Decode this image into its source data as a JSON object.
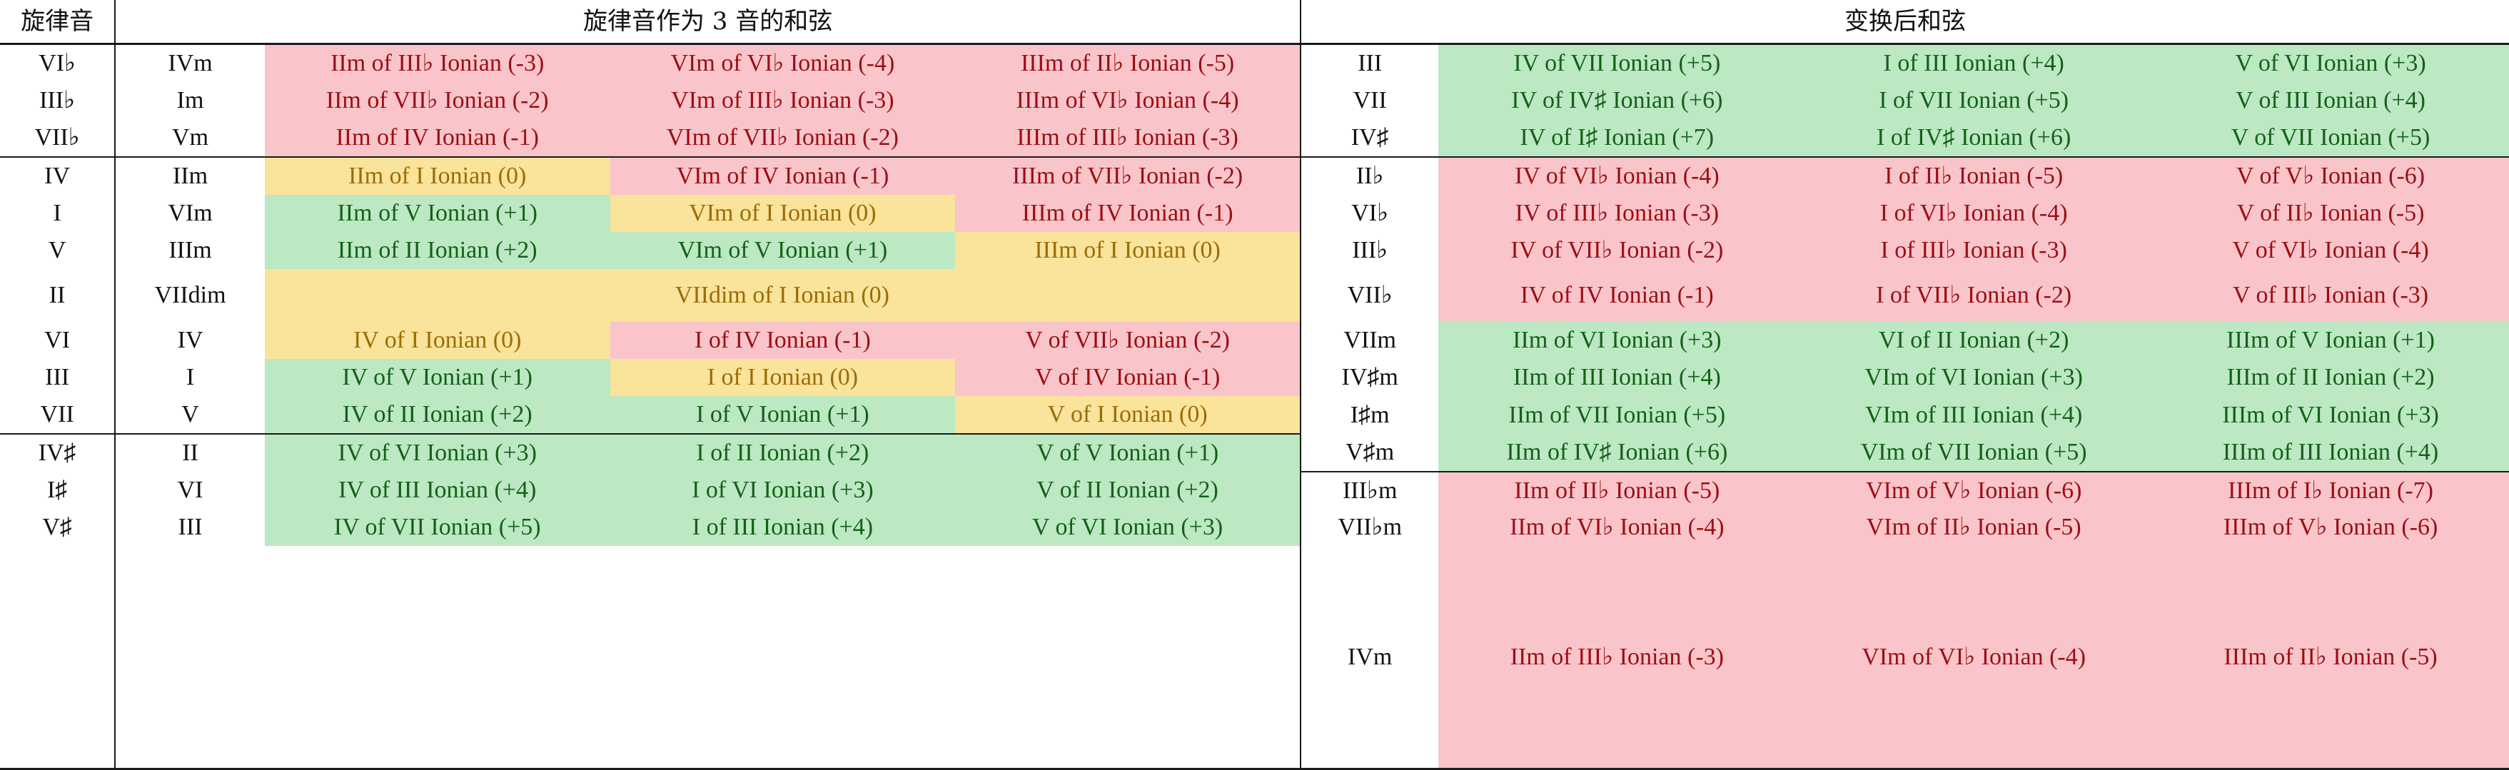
{
  "header": {
    "melody_label": "旋律音",
    "left_group": "旋律音作为 3 音的和弦",
    "right_group": "变换后和弦"
  },
  "left_table": {
    "blocks": [
      {
        "rows": [
          {
            "melody": "VI♭",
            "chord": "IVm",
            "color": [
              "pink",
              "pink",
              "pink"
            ],
            "cells": [
              "IIm of III♭ Ionian (-3)",
              "VIm of VI♭ Ionian (-4)",
              "IIIm of II♭ Ionian (-5)"
            ]
          },
          {
            "melody": "III♭",
            "chord": "Im",
            "color": [
              "pink",
              "pink",
              "pink"
            ],
            "cells": [
              "IIm of VII♭ Ionian (-2)",
              "VIm of III♭ Ionian (-3)",
              "IIIm of VI♭ Ionian (-4)"
            ]
          },
          {
            "melody": "VII♭",
            "chord": "Vm",
            "color": [
              "pink",
              "pink",
              "pink"
            ],
            "cells": [
              "IIm of IV Ionian (-1)",
              "VIm of VII♭ Ionian (-2)",
              "IIIm of III♭ Ionian (-3)"
            ]
          }
        ]
      },
      {
        "rows": [
          {
            "melody": "IV",
            "chord": "IIm",
            "color": [
              "yellow",
              "pink",
              "pink"
            ],
            "cells": [
              "IIm of I Ionian (0)",
              "VIm of IV Ionian (-1)",
              "IIIm of VII♭ Ionian (-2)"
            ]
          },
          {
            "melody": "I",
            "chord": "VIm",
            "color": [
              "green",
              "yellow",
              "pink"
            ],
            "cells": [
              "IIm of V Ionian (+1)",
              "VIm of I Ionian (0)",
              "IIIm of IV Ionian (-1)"
            ]
          },
          {
            "melody": "V",
            "chord": "IIIm",
            "color": [
              "green",
              "green",
              "yellow"
            ],
            "cells": [
              "IIm of II Ionian (+2)",
              "VIm of V Ionian (+1)",
              "IIIm of I Ionian (0)"
            ]
          },
          {
            "melody": "II",
            "chord": "VIIdim",
            "span": true,
            "color": [
              "yellow"
            ],
            "cells": [
              "VIIdim of I Ionian (0)"
            ]
          },
          {
            "melody": "VI",
            "chord": "IV",
            "color": [
              "yellow",
              "pink",
              "pink"
            ],
            "cells": [
              "IV of I Ionian (0)",
              "I of IV Ionian (-1)",
              "V of VII♭ Ionian (-2)"
            ]
          },
          {
            "melody": "III",
            "chord": "I",
            "color": [
              "green",
              "yellow",
              "pink"
            ],
            "cells": [
              "IV of V Ionian (+1)",
              "I of I Ionian (0)",
              "V of IV Ionian (-1)"
            ]
          },
          {
            "melody": "VII",
            "chord": "V",
            "color": [
              "green",
              "green",
              "yellow"
            ],
            "cells": [
              "IV of II Ionian (+2)",
              "I of V Ionian (+1)",
              "V of I Ionian (0)"
            ]
          }
        ]
      },
      {
        "rows": [
          {
            "melody": "IV♯",
            "chord": "II",
            "color": [
              "green",
              "green",
              "green"
            ],
            "cells": [
              "IV of VI Ionian (+3)",
              "I of II Ionian (+2)",
              "V of V Ionian (+1)"
            ]
          },
          {
            "melody": "I♯",
            "chord": "VI",
            "color": [
              "green",
              "green",
              "green"
            ],
            "cells": [
              "IV of III Ionian (+4)",
              "I of VI Ionian (+3)",
              "V of II Ionian (+2)"
            ]
          },
          {
            "melody": "V♯",
            "chord": "III",
            "color": [
              "green",
              "green",
              "green"
            ],
            "cells": [
              "IV of VII Ionian (+5)",
              "I of III Ionian (+4)",
              "V of VI Ionian (+3)"
            ]
          }
        ]
      }
    ]
  },
  "right_table": {
    "blocks": [
      {
        "rows": [
          {
            "melody": "III",
            "color": [
              "green",
              "green",
              "green"
            ],
            "cells": [
              "IV of VII Ionian (+5)",
              "I of III Ionian (+4)",
              "V of VI Ionian (+3)"
            ]
          },
          {
            "melody": "VII",
            "color": [
              "green",
              "green",
              "green"
            ],
            "cells": [
              "IV of IV♯ Ionian (+6)",
              "I of VII Ionian (+5)",
              "V of III Ionian (+4)"
            ]
          },
          {
            "melody": "IV♯",
            "color": [
              "green",
              "green",
              "green"
            ],
            "cells": [
              "IV of I♯ Ionian (+7)",
              "I of IV♯ Ionian (+6)",
              "V of VII Ionian (+5)"
            ]
          }
        ]
      },
      {
        "rows": [
          {
            "melody": "II♭",
            "color": [
              "pink",
              "pink",
              "pink"
            ],
            "cells": [
              "IV of VI♭ Ionian (-4)",
              "I of II♭ Ionian (-5)",
              "V of V♭ Ionian (-6)"
            ]
          },
          {
            "melody": "VI♭",
            "color": [
              "pink",
              "pink",
              "pink"
            ],
            "cells": [
              "IV of III♭ Ionian (-3)",
              "I of VI♭ Ionian (-4)",
              "V of II♭ Ionian (-5)"
            ]
          },
          {
            "melody": "III♭",
            "color": [
              "pink",
              "pink",
              "pink"
            ],
            "cells": [
              "IV of VII♭ Ionian (-2)",
              "I of III♭ Ionian (-3)",
              "V of VI♭ Ionian (-4)"
            ]
          },
          {
            "melody": "VII♭",
            "color": [
              "pink",
              "pink",
              "pink"
            ],
            "cells": [
              "IV of IV Ionian (-1)",
              "I of VII♭ Ionian (-2)",
              "V of III♭ Ionian (-3)"
            ]
          },
          {
            "melody": "VIIm",
            "color": [
              "green",
              "green",
              "green"
            ],
            "cells": [
              "IIm of VI Ionian (+3)",
              "VI of II Ionian (+2)",
              "IIIm of V Ionian (+1)"
            ]
          },
          {
            "melody": "IV♯m",
            "color": [
              "green",
              "green",
              "green"
            ],
            "cells": [
              "IIm of III Ionian (+4)",
              "VIm of VI Ionian (+3)",
              "IIIm of II Ionian (+2)"
            ]
          },
          {
            "melody": "I♯m",
            "color": [
              "green",
              "green",
              "green"
            ],
            "cells": [
              "IIm of VII Ionian (+5)",
              "VIm of III Ionian (+4)",
              "IIIm of VI Ionian (+3)"
            ]
          },
          {
            "melody": "V♯m",
            "color": [
              "green",
              "green",
              "green"
            ],
            "cells": [
              "IIm of IV♯ Ionian (+6)",
              "VIm of VII Ionian (+5)",
              "IIIm of III Ionian (+4)"
            ]
          }
        ]
      },
      {
        "rows": [
          {
            "melody": "III♭m",
            "color": [
              "pink",
              "pink",
              "pink"
            ],
            "cells": [
              "IIm of II♭ Ionian (-5)",
              "VIm of V♭ Ionian (-6)",
              "IIIm of I♭ Ionian (-7)"
            ]
          },
          {
            "melody": "VII♭m",
            "color": [
              "pink",
              "pink",
              "pink"
            ],
            "cells": [
              "IIm of VI♭ Ionian (-4)",
              "VIm of II♭ Ionian (-5)",
              "IIIm of V♭ Ionian (-6)"
            ]
          },
          {
            "melody": "IVm",
            "color": [
              "pink",
              "pink",
              "pink"
            ],
            "cells": [
              "IIm of III♭ Ionian (-3)",
              "VIm of VI♭ Ionian (-4)",
              "IIIm of II♭ Ionian (-5)"
            ]
          }
        ]
      }
    ]
  },
  "colors": {
    "pink_bg": "#f9c5ca",
    "pink_fg": "#9c0d14",
    "green_bg": "#bce8c4",
    "green_fg": "#136117",
    "yellow_bg": "#fae39a",
    "yellow_fg": "#9b6c07",
    "rule": "#1a1a1a"
  }
}
